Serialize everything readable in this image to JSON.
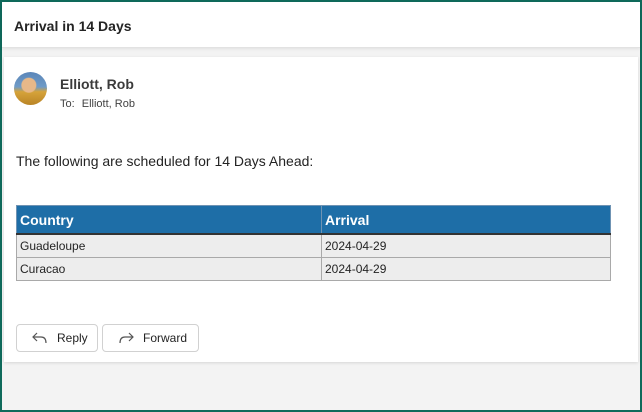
{
  "subject": "Arrival in 14 Days",
  "message": {
    "sender": "Elliott, Rob",
    "to_label": "To:",
    "to_name": "Elliott, Rob",
    "intro": "The following are scheduled for 14 Days Ahead:",
    "table": {
      "headers": [
        "Country",
        "Arrival"
      ],
      "rows": [
        [
          "Guadeloupe",
          "2024-04-29"
        ],
        [
          "Curacao",
          "2024-04-29"
        ]
      ]
    }
  },
  "actions": {
    "reply_label": "Reply",
    "forward_label": "Forward",
    "reply_icon": "reply-arrow-icon",
    "forward_icon": "forward-arrow-icon"
  },
  "colors": {
    "frame": "#0f6a5b",
    "table_header": "#1e6ea7"
  }
}
